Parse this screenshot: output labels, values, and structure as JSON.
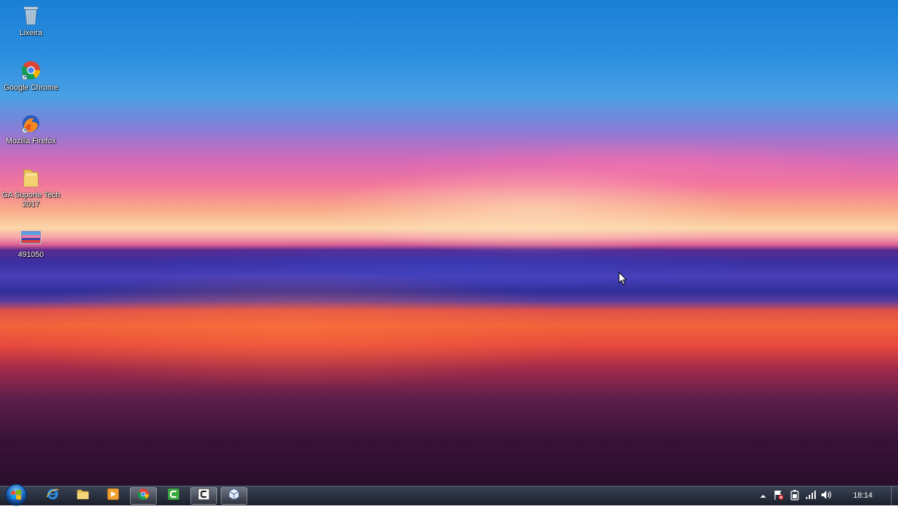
{
  "desktop": {
    "icons": [
      {
        "label": "Lixeira",
        "icon": "recycle-bin-icon"
      },
      {
        "label": "Google Chrome",
        "icon": "chrome-icon"
      },
      {
        "label": "Mozilla Firefox",
        "icon": "firefox-icon"
      },
      {
        "label": "GA Suporte Tech 2017",
        "icon": "folder-icon"
      },
      {
        "label": "491050",
        "icon": "image-file-icon"
      }
    ]
  },
  "taskbar": {
    "pinned": [
      {
        "name": "internet-explorer",
        "icon": "internet-explorer-icon"
      },
      {
        "name": "file-explorer",
        "icon": "folder-icon"
      },
      {
        "name": "media-player",
        "icon": "media-player-icon"
      },
      {
        "name": "google-chrome",
        "icon": "chrome-icon"
      },
      {
        "name": "camtasia",
        "icon": "camtasia-icon"
      },
      {
        "name": "app-c",
        "icon": "c-app-icon"
      },
      {
        "name": "virtualbox",
        "icon": "virtualbox-icon"
      }
    ],
    "tray": {
      "icons": [
        "show-hidden-icons-icon",
        "action-center-flag-icon",
        "power-icon",
        "network-signal-icon",
        "volume-icon"
      ]
    },
    "clock": "18:14"
  }
}
